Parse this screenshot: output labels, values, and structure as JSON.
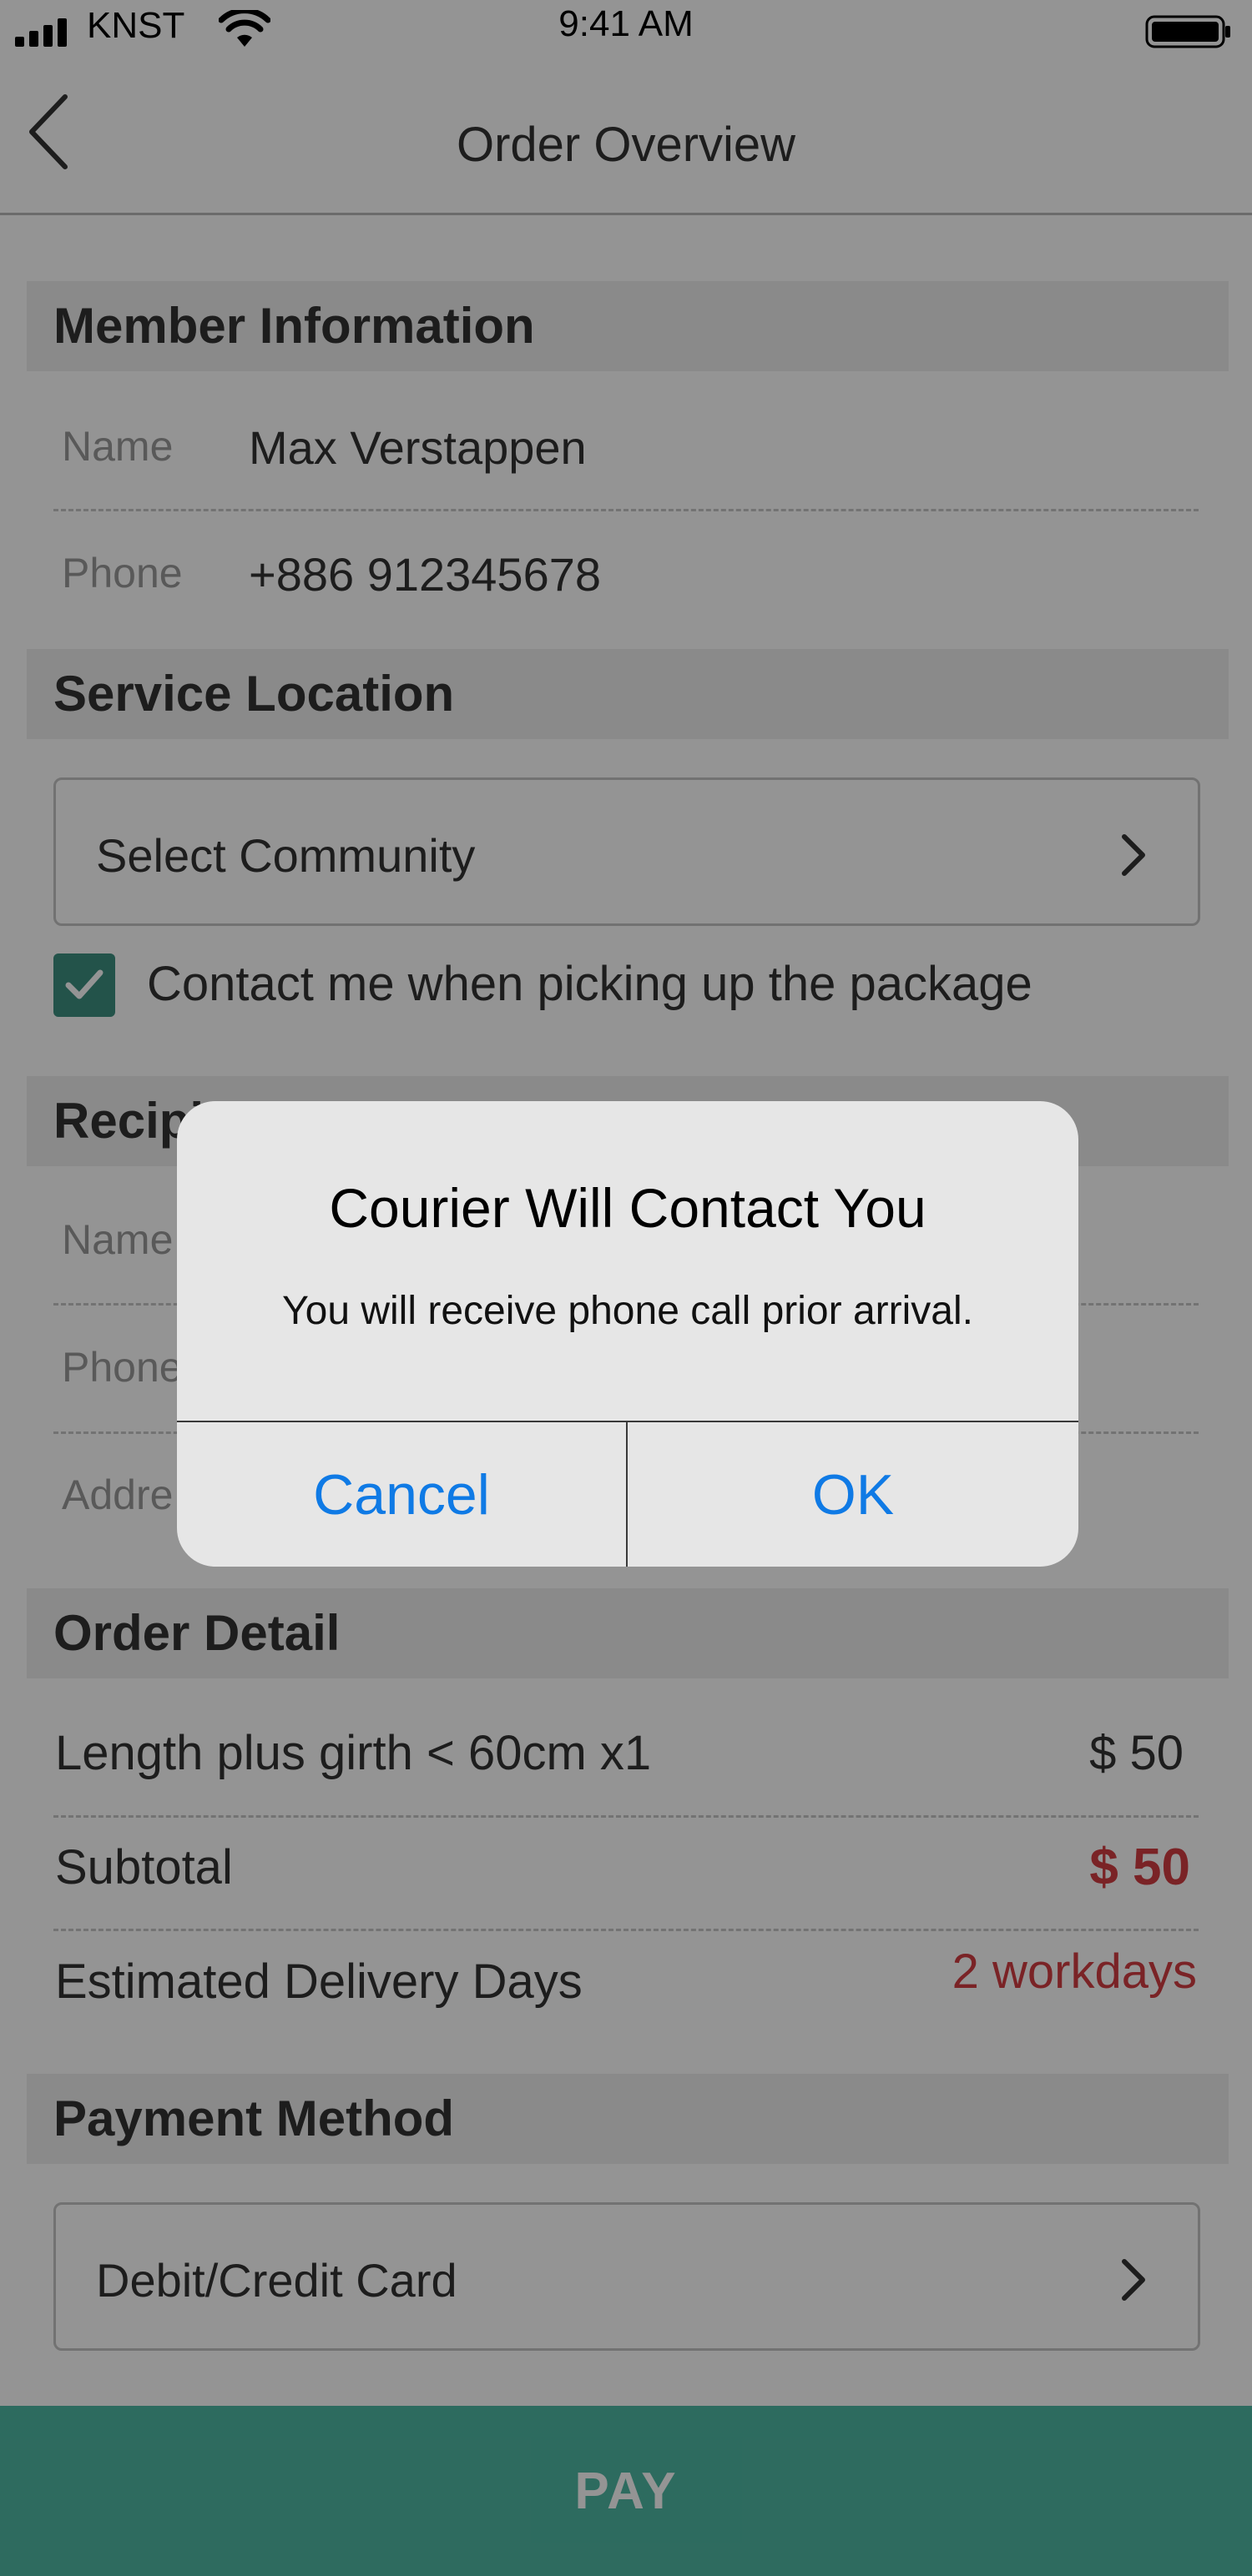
{
  "status_bar": {
    "carrier": "KNST",
    "time": "9:41 AM",
    "icons": [
      "signal-bars-icon",
      "wifi-icon",
      "battery-icon"
    ]
  },
  "nav": {
    "back_icon": "chevron-left-icon",
    "title": "Order Overview"
  },
  "member": {
    "header": "Member Information",
    "name_label": "Name",
    "name_value": "Max Verstappen",
    "phone_label": "Phone",
    "phone_value": "+886 912345678"
  },
  "service": {
    "header": "Service Location",
    "select_placeholder": "Select Community",
    "contact_checked": true,
    "contact_label": "Contact me when picking up the package"
  },
  "recipient": {
    "header": "Recipi",
    "name_label": "Name",
    "phone_label": "Phone",
    "address_label": "Addre"
  },
  "order": {
    "header": "Order Detail",
    "item_label": "Length plus girth < 60cm x1",
    "item_amount": "$ 50",
    "subtotal_label": "Subtotal",
    "subtotal_amount": "$ 50",
    "delivery_label": "Estimated Delivery Days",
    "delivery_value": "2 workdays"
  },
  "payment": {
    "header": "Payment Method",
    "method": "Debit/Credit Card"
  },
  "pay_button": "PAY",
  "alert": {
    "title": "Courier Will Contact You",
    "message": "You will receive phone call prior arrival.",
    "cancel": "Cancel",
    "ok": "OK"
  },
  "colors": {
    "accent": "#4fb9a4",
    "price_red": "#d23d42",
    "ios_blue": "#0f7ae5",
    "section_bg": "#eeeeee"
  }
}
